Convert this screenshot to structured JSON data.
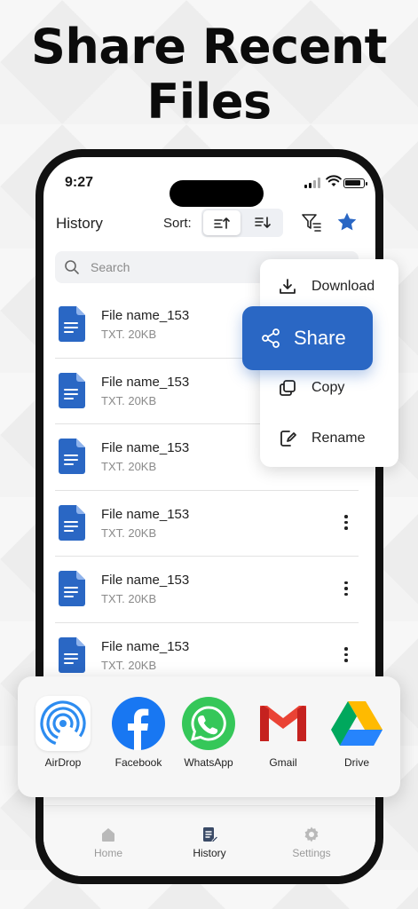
{
  "headline": {
    "line1": "Share Recent",
    "line2": "Files"
  },
  "status": {
    "time": "9:27"
  },
  "header": {
    "title": "History",
    "sort_label": "Sort:",
    "sort_active": "ascending"
  },
  "search": {
    "placeholder": "Search"
  },
  "files": [
    {
      "name": "File name_153",
      "meta": "TXT. 20KB"
    },
    {
      "name": "File name_153",
      "meta": "TXT. 20KB"
    },
    {
      "name": "File name_153",
      "meta": "TXT. 20KB"
    },
    {
      "name": "File name_153",
      "meta": "TXT. 20KB"
    },
    {
      "name": "File name_153",
      "meta": "TXT. 20KB"
    },
    {
      "name": "File name_153",
      "meta": "TXT. 20KB"
    }
  ],
  "context_menu": {
    "items": [
      {
        "label": "Download",
        "icon": "download-icon"
      },
      {
        "label": "Share",
        "icon": "share-icon"
      },
      {
        "label": "Copy",
        "icon": "copy-icon"
      },
      {
        "label": "Rename",
        "icon": "rename-icon"
      }
    ]
  },
  "share_sheet": {
    "apps": [
      {
        "label": "AirDrop",
        "icon": "airdrop-icon"
      },
      {
        "label": "Facebook",
        "icon": "facebook-icon"
      },
      {
        "label": "WhatsApp",
        "icon": "whatsapp-icon"
      },
      {
        "label": "Gmail",
        "icon": "gmail-icon"
      },
      {
        "label": "Drive",
        "icon": "drive-icon"
      }
    ]
  },
  "tabbar": {
    "tabs": [
      {
        "label": "Home",
        "icon": "home-icon"
      },
      {
        "label": "History",
        "icon": "history-icon",
        "active": true
      },
      {
        "label": "Settings",
        "icon": "settings-icon"
      }
    ]
  },
  "colors": {
    "accent": "#2a67c4",
    "file_icon": "#2a67c4"
  }
}
